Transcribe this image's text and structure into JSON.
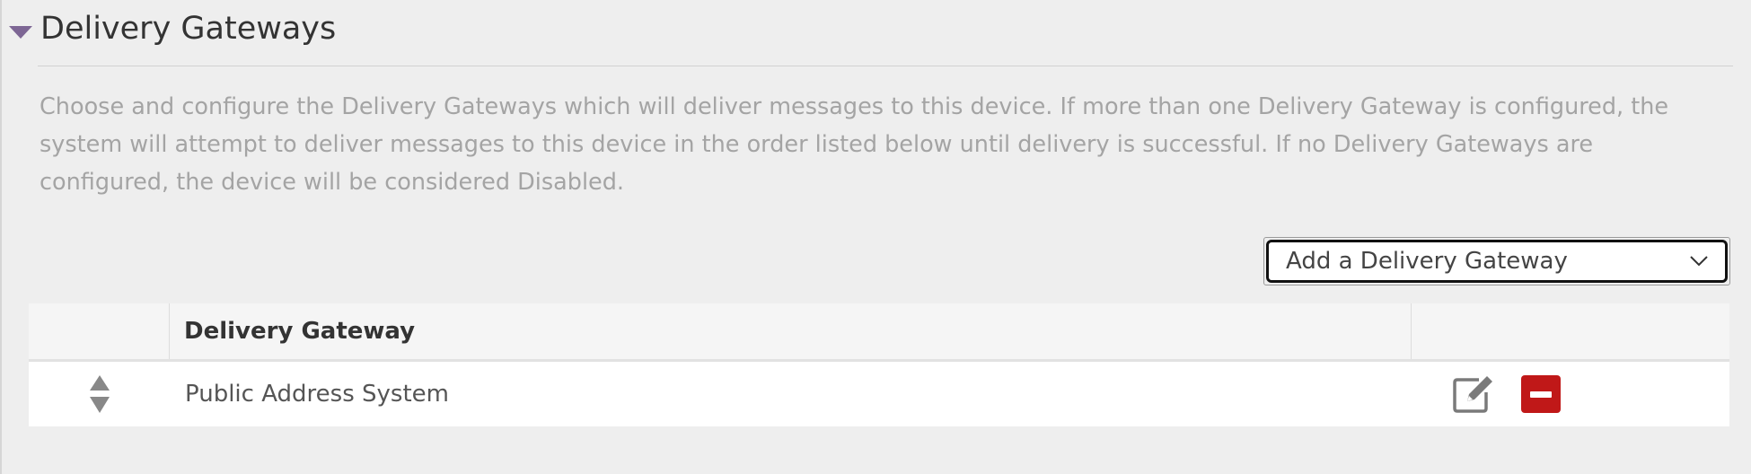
{
  "section": {
    "title": "Delivery Gateways",
    "description": "Choose and configure the Delivery Gateways which will deliver messages to this device. If more than one Delivery Gateway is configured, the system will attempt to deliver messages to this device in the order listed below until delivery is successful. If no Delivery Gateways are configured, the device will be considered Disabled."
  },
  "add_select": {
    "selected": "Add a Delivery Gateway"
  },
  "table": {
    "columns": [
      "",
      "Delivery Gateway",
      ""
    ],
    "rows": [
      {
        "name": "Public Address System"
      }
    ]
  },
  "colors": {
    "accent_caret": "#7d6694",
    "remove_button": "#c01818",
    "description_text": "#a4a4a4"
  },
  "icons": {
    "collapse": "caret-down-icon",
    "select": "chevron-down-icon",
    "reorder": "sort-handle-icon",
    "edit": "edit-icon",
    "remove": "minus-icon"
  }
}
